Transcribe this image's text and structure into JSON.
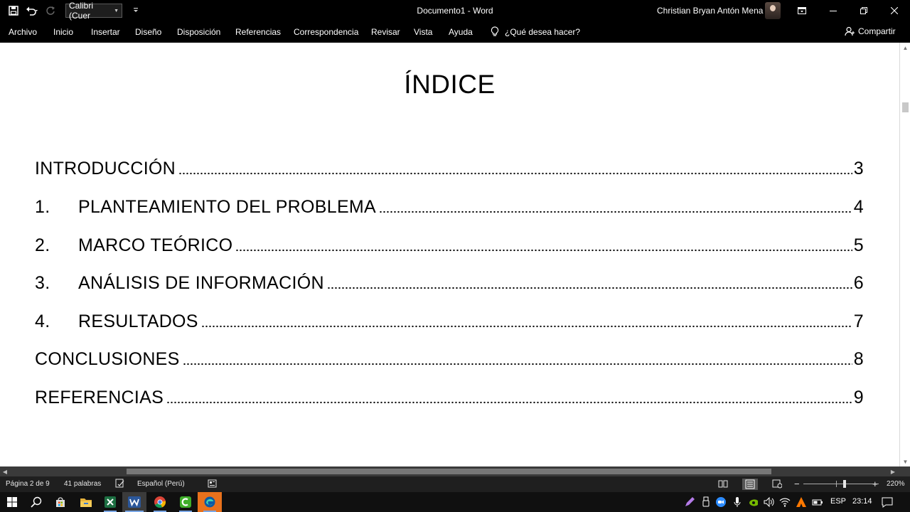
{
  "titlebar": {
    "font_box": "Calibri (Cuer",
    "doc_title": "Documento1  -  Word",
    "user_name": "Christian Bryan Antón Mena"
  },
  "menu": {
    "tabs": [
      "Archivo",
      "Inicio",
      "Insertar",
      "Diseño",
      "Disposición",
      "Referencias",
      "Correspondencia",
      "Revisar",
      "Vista",
      "Ayuda"
    ],
    "tell_me": "¿Qué desea hacer?",
    "share": "Compartir"
  },
  "document": {
    "heading": "ÍNDICE",
    "toc": [
      {
        "num": "",
        "title": "INTRODUCCIÓN",
        "page": "3"
      },
      {
        "num": "1.",
        "title": "PLANTEAMIENTO DEL PROBLEMA",
        "page": "4"
      },
      {
        "num": "2.",
        "title": "MARCO TEÓRICO",
        "page": "5"
      },
      {
        "num": "3.",
        "title": "ANÁLISIS DE INFORMACIÓN",
        "page": "6"
      },
      {
        "num": "4.",
        "title": "RESULTADOS",
        "page": "7"
      },
      {
        "num": "",
        "title": "CONCLUSIONES",
        "page": "8"
      },
      {
        "num": "",
        "title": "REFERENCIAS",
        "page": "9"
      }
    ]
  },
  "statusbar": {
    "page": "Página 2 de 9",
    "words": "41 palabras",
    "language": "Español (Perú)",
    "zoom_minus": "−",
    "zoom_plus": "+",
    "zoom": "220%"
  },
  "taskbar": {
    "apps": [
      "start-icon",
      "search-icon",
      "store-icon",
      "file-explorer-icon",
      "excel-icon",
      "word-icon",
      "chrome-icon",
      "camtasia-icon",
      "edge-icon"
    ],
    "lang": "ESP",
    "time": "23:14"
  },
  "colors": {
    "excel": "#1d6f42",
    "word": "#2b579a",
    "camtasia": "#3fae2a",
    "edge_bg": "#e8711c",
    "accent": "#7aa7e6"
  }
}
